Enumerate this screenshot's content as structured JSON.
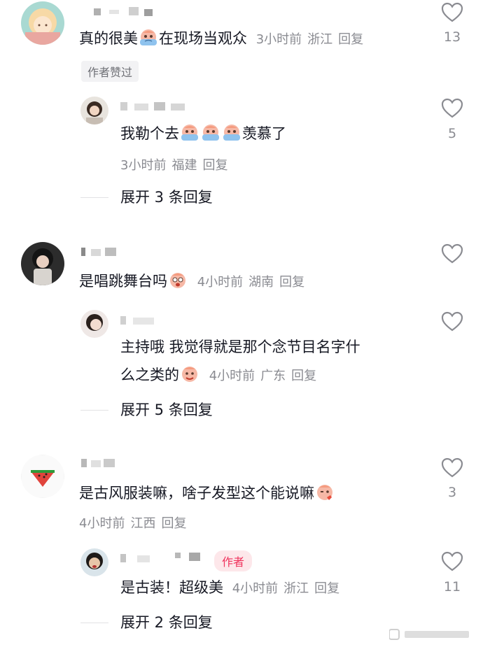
{
  "comments": [
    {
      "text": "真的很美",
      "text_after": "在现场当观众",
      "emoji": "crying-emoji-icon",
      "time": "3小时前",
      "location": "浙江",
      "reply": "回复",
      "likes": "13",
      "badge": "作者赞过",
      "replies": [
        {
          "text": "我勒个去",
          "text_after": "羡慕了",
          "emojis": [
            "crying-emoji-icon",
            "crying-emoji-icon",
            "crying-emoji-icon"
          ],
          "time": "3小时前",
          "location": "福建",
          "reply": "回复",
          "likes": "5"
        }
      ],
      "expand": "展开 3 条回复"
    },
    {
      "text": "是唱跳舞台吗",
      "emoji": "shocked-emoji-icon",
      "time": "4小时前",
      "location": "湖南",
      "reply": "回复",
      "likes": "",
      "replies": [
        {
          "text_line1": "主持哦 我觉得就是那个念节目名字什",
          "text_line2": "么之类的",
          "emoji": "smile-emoji-icon",
          "time": "4小时前",
          "location": "广东",
          "reply": "回复",
          "likes": ""
        }
      ],
      "expand": "展开 5 条回复"
    },
    {
      "text": "是古风服装嘛，啥子发型这个能说嘛",
      "emoji": "kiss-emoji-icon",
      "time": "4小时前",
      "location": "江西",
      "reply": "回复",
      "likes": "3",
      "replies": [
        {
          "author_tag": "作者",
          "text": "是古装！超级美",
          "time": "4小时前",
          "location": "浙江",
          "reply": "回复",
          "likes": "11"
        }
      ],
      "expand": "展开 2 条回复"
    }
  ],
  "colors": {
    "text": "#161823",
    "meta": "#8a8b91",
    "author_tag_bg": "#fde7ea",
    "author_tag_text": "#f0325c",
    "badge_bg": "#f2f2f4"
  }
}
